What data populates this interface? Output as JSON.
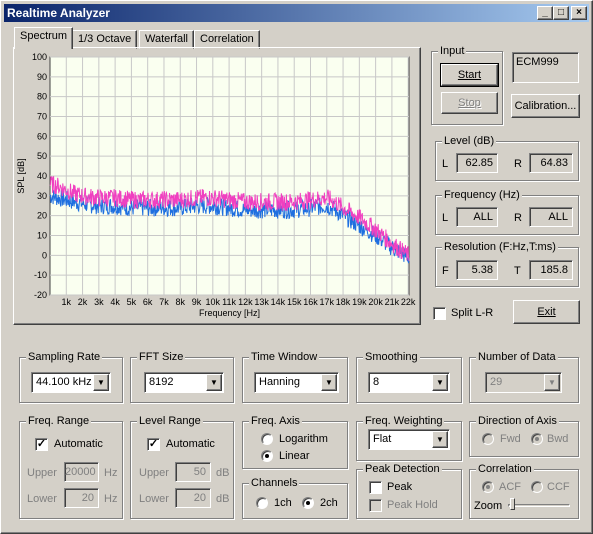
{
  "window": {
    "title": "Realtime Analyzer",
    "controls": [
      "_",
      "□",
      "×"
    ]
  },
  "tabs": [
    "Spectrum",
    "1/3 Octave",
    "Waterfall",
    "Correlation"
  ],
  "active_tab": "Spectrum",
  "chart_data": {
    "type": "line",
    "ylabel": "SPL [dB]",
    "xlabel": "Frequency  [Hz]",
    "ylim": [
      -20,
      100
    ],
    "yticks": [
      "100",
      "90",
      "80",
      "70",
      "60",
      "50",
      "40",
      "30",
      "20",
      "10",
      "0",
      "-10",
      "-20"
    ],
    "xticks": [
      "1k",
      "2k",
      "3k",
      "4k",
      "5k",
      "6k",
      "7k",
      "8k",
      "9k",
      "10k",
      "11k",
      "12k",
      "13k",
      "14k",
      "15k",
      "16k",
      "17k",
      "18k",
      "19k",
      "20k",
      "21k",
      "22k"
    ],
    "xlim": [
      0,
      22050
    ],
    "grid": true,
    "series": [
      {
        "color": "#1e6fe0",
        "x": [
          0,
          500,
          1000,
          1500,
          2000,
          3000,
          4000,
          5000,
          6000,
          7000,
          8000,
          9000,
          10000,
          11000,
          12000,
          13000,
          14000,
          15000,
          16000,
          17000,
          17500,
          18000,
          19000,
          20000,
          21000,
          22000
        ],
        "values": [
          30,
          29,
          28,
          27,
          26,
          25,
          25,
          24,
          24,
          24,
          24,
          25,
          25,
          24,
          23,
          23,
          23,
          23,
          24,
          25,
          23,
          20,
          15,
          10,
          4,
          -1
        ]
      },
      {
        "color": "#f040c0",
        "x": [
          0,
          500,
          1000,
          1500,
          2000,
          3000,
          4000,
          5000,
          6000,
          7000,
          8000,
          9000,
          10000,
          11000,
          12000,
          13000,
          14000,
          15000,
          16000,
          17000,
          17500,
          18000,
          19000,
          20000,
          21000,
          22000
        ],
        "values": [
          36,
          35,
          33,
          31,
          30,
          29,
          29,
          28,
          28,
          28,
          28,
          29,
          29,
          28,
          27,
          27,
          27,
          27,
          28,
          29,
          27,
          24,
          19,
          13,
          6,
          0
        ]
      }
    ]
  },
  "input": {
    "group_label": "Input",
    "start_label": "Start",
    "stop_label": "Stop",
    "calibration_label": "Calibration...",
    "device": "ECM999"
  },
  "level": {
    "label": "Level (dB)",
    "l_label": "L",
    "l_value": "62.85",
    "r_label": "R",
    "r_value": "64.83"
  },
  "frequency": {
    "label": "Frequency (Hz)",
    "l_label": "L",
    "l_value": "ALL",
    "r_label": "R",
    "r_value": "ALL"
  },
  "resolution": {
    "label": "Resolution (F:Hz,T:ms)",
    "f_label": "F",
    "f_value": "5.38",
    "t_label": "T",
    "t_value": "185.8"
  },
  "split_label": "Split L-R",
  "exit_label": "Exit",
  "sampling_rate": {
    "label": "Sampling Rate",
    "value": "44.100 kHz"
  },
  "fft_size": {
    "label": "FFT Size",
    "value": "8192"
  },
  "time_window": {
    "label": "Time Window",
    "value": "Hanning"
  },
  "smoothing": {
    "label": "Smoothing",
    "value": "8"
  },
  "number_of_data": {
    "label": "Number of Data",
    "value": "29"
  },
  "freq_range": {
    "label": "Freq. Range",
    "auto_label": "Automatic",
    "upper_label": "Upper",
    "upper_value": "20000",
    "lower_label": "Lower",
    "lower_value": "20",
    "unit": "Hz"
  },
  "level_range": {
    "label": "Level Range",
    "auto_label": "Automatic",
    "upper_label": "Upper",
    "upper_value": "50",
    "lower_label": "Lower",
    "lower_value": "20",
    "unit": "dB"
  },
  "freq_axis": {
    "label": "Freq. Axis",
    "log_label": "Logarithm",
    "lin_label": "Linear",
    "selected": "Linear"
  },
  "channels": {
    "label": "Channels",
    "ch1_label": "1ch",
    "ch2_label": "2ch",
    "selected": "2ch"
  },
  "freq_weighting": {
    "label": "Freq. Weighting",
    "value": "Flat"
  },
  "peak_detection": {
    "label": "Peak Detection",
    "peak_label": "Peak",
    "hold_label": "Peak Hold"
  },
  "direction": {
    "label": "Direction of Axis",
    "fwd_label": "Fwd",
    "bwd_label": "Bwd",
    "selected": "Bwd"
  },
  "correlation": {
    "label": "Correlation",
    "acf_label": "ACF",
    "ccf_label": "CCF",
    "selected": "ACF",
    "zoom_label": "Zoom"
  }
}
